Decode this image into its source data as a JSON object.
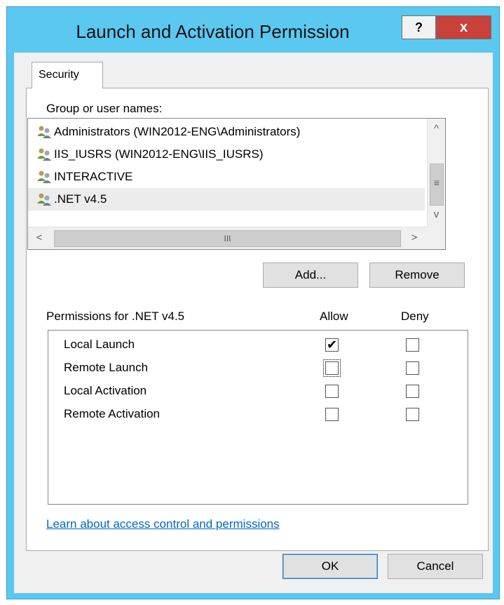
{
  "window": {
    "title": "Launch and Activation Permission",
    "help_label": "?",
    "close_label": "x"
  },
  "tab": {
    "label": "Security"
  },
  "groups": {
    "label": "Group or user names:",
    "items": [
      {
        "name": "Administrators (WIN2012-ENG\\Administrators)",
        "icon": "user-group-icon"
      },
      {
        "name": "IIS_IUSRS (WIN2012-ENG\\IIS_IUSRS)",
        "icon": "user-group-icon"
      },
      {
        "name": "INTERACTIVE",
        "icon": "user-group-icon"
      },
      {
        "name": ".NET v4.5",
        "icon": "user-group-icon",
        "selected": true
      }
    ],
    "scroll": {
      "up": "^",
      "grip": "≡",
      "down": "v",
      "left": "<",
      "hgrip": "III",
      "right": ">"
    }
  },
  "buttons": {
    "add": "Add...",
    "remove": "Remove",
    "ok": "OK",
    "cancel": "Cancel"
  },
  "permissions": {
    "label": "Permissions for .NET v4.5",
    "allow_header": "Allow",
    "deny_header": "Deny",
    "rows": [
      {
        "name": "Local Launch",
        "allow": true,
        "deny": false
      },
      {
        "name": "Remote Launch",
        "allow": false,
        "deny": false
      },
      {
        "name": "Local Activation",
        "allow": false,
        "deny": false
      },
      {
        "name": "Remote Activation",
        "allow": false,
        "deny": false
      }
    ]
  },
  "checkmark": "✔",
  "link": "Learn about access control and permissions",
  "colors": {
    "titlebar": "#5bc8f0",
    "close": "#c8413a",
    "link": "#0066cc"
  }
}
